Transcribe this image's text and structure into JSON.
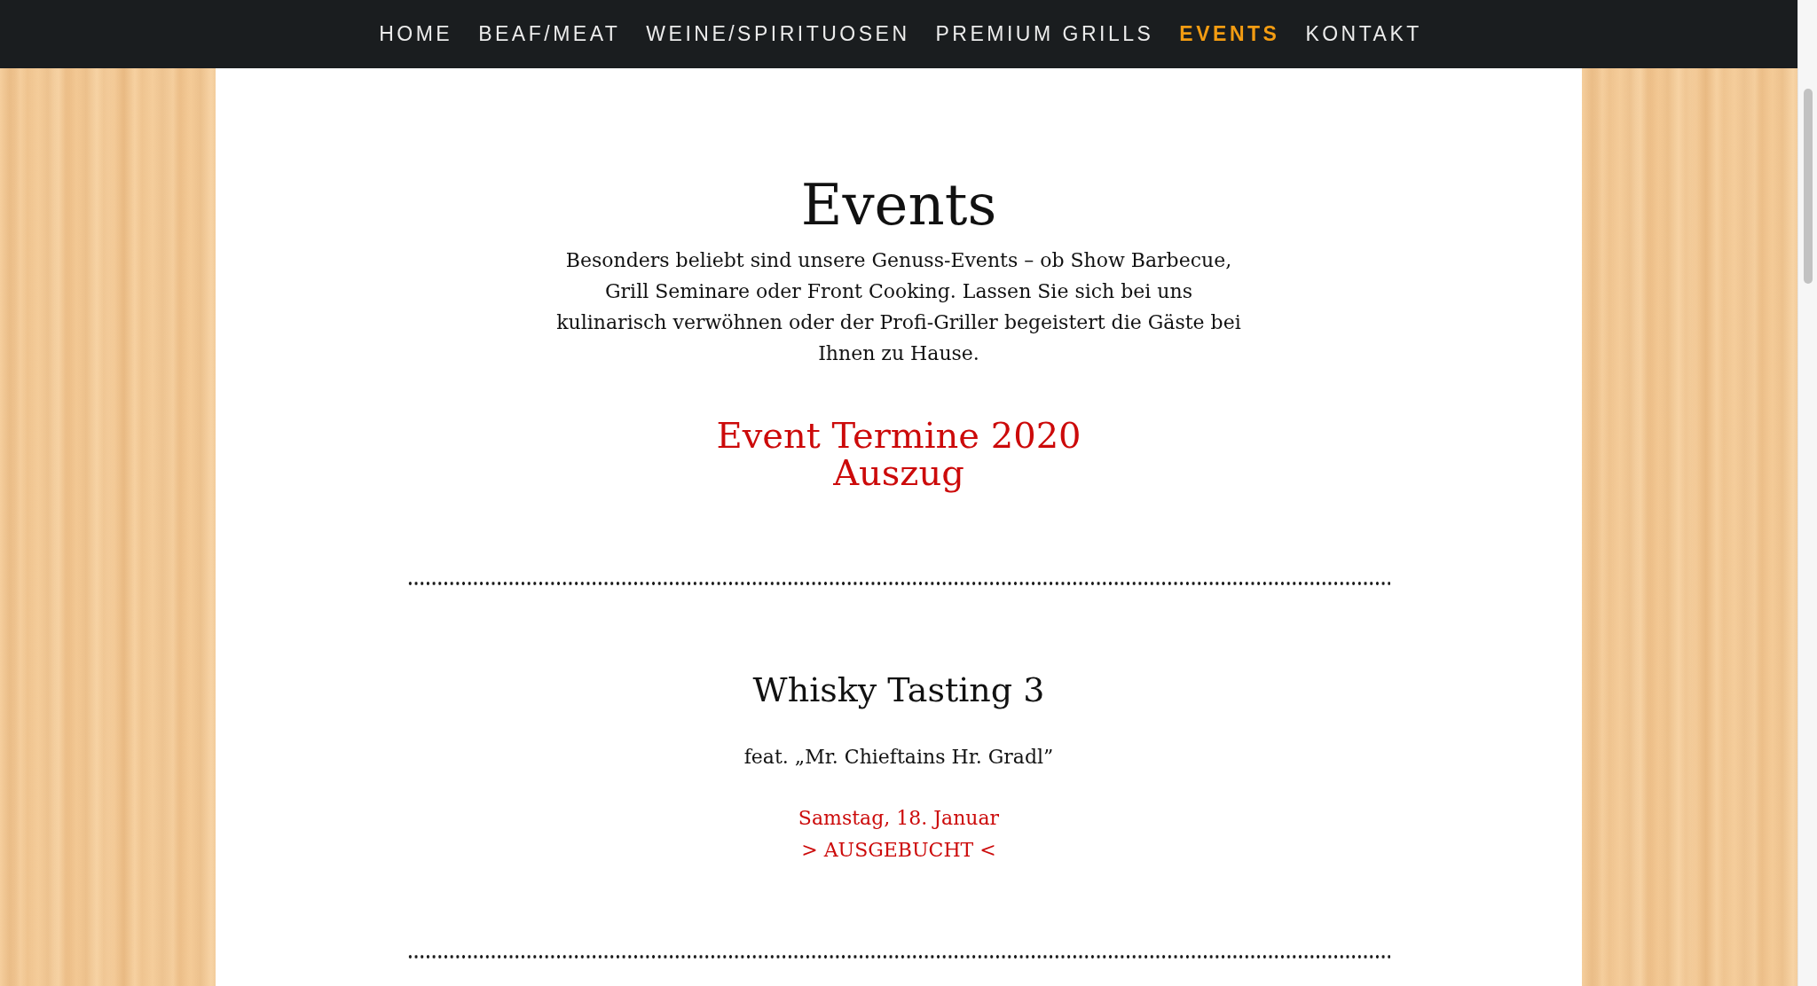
{
  "nav": {
    "items": [
      {
        "label": "HOME",
        "selected": false
      },
      {
        "label": "BEAF/MEAT",
        "selected": false
      },
      {
        "label": "WEINE/SPIRITUOSEN",
        "selected": false
      },
      {
        "label": "PREMIUM GRILLS",
        "selected": false
      },
      {
        "label": "EVENTS",
        "selected": true
      },
      {
        "label": "KONTAKT",
        "selected": false
      }
    ]
  },
  "page": {
    "title": "Events",
    "intro": "Besonders beliebt sind unsere Genuss-Events – ob Show Barbecue, Grill Seminare oder Front Cooking. Lassen Sie sich bei uns kulinarisch verwöhnen oder der Profi-Griller begeistert die Gäste bei Ihnen zu Hause.",
    "section_heading": "Event Termine 2020\nAuszug"
  },
  "events": [
    {
      "title": "Whisky Tasting 3",
      "subtitle": "feat. „Mr. Chieftains Hr. Gradl”",
      "date": "Samstag, 18. Januar",
      "status": "> AUSGEBUCHT <"
    }
  ]
}
